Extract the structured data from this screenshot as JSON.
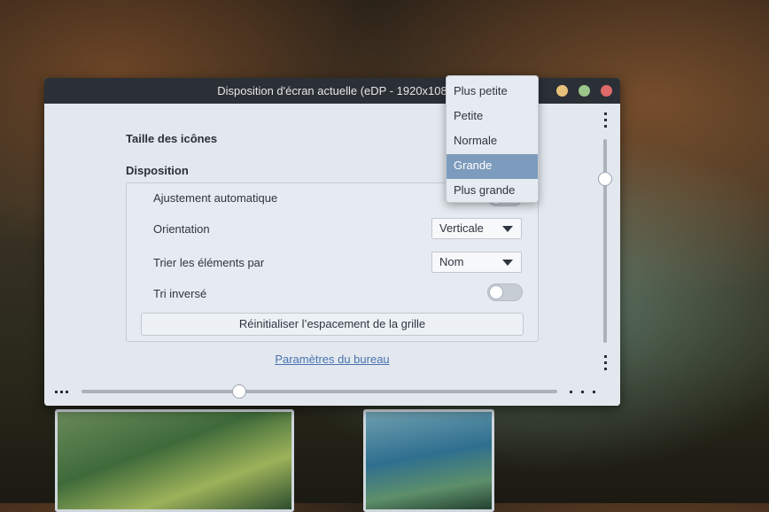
{
  "window": {
    "title": "Disposition d'écran actuelle (eDP - 1920x108"
  },
  "content": {
    "icon_size_label": "Taille des icônes",
    "layout_label": "Disposition",
    "auto_adjust_label": "Ajustement automatique",
    "orientation_label": "Orientation",
    "orientation_value": "Verticale",
    "sort_by_label": "Trier les éléments par",
    "sort_by_value": "Nom",
    "reverse_sort_label": "Tri inversé",
    "reset_button_label": "Réinitialiser l’espacement de la grille",
    "desktop_settings_link": "Paramètres du bureau"
  },
  "toggles": {
    "auto_adjust": false,
    "reverse_sort": false
  },
  "dropdown": {
    "items": [
      "Plus petite",
      "Petite",
      "Normale",
      "Grande",
      "Plus grande"
    ],
    "selected": "Grande"
  },
  "colors": {
    "accent": "#7d9cbd",
    "link": "#4a72b0",
    "close": "#e06a6a",
    "minimize": "#e8c27a",
    "maximize": "#9cc68a"
  }
}
